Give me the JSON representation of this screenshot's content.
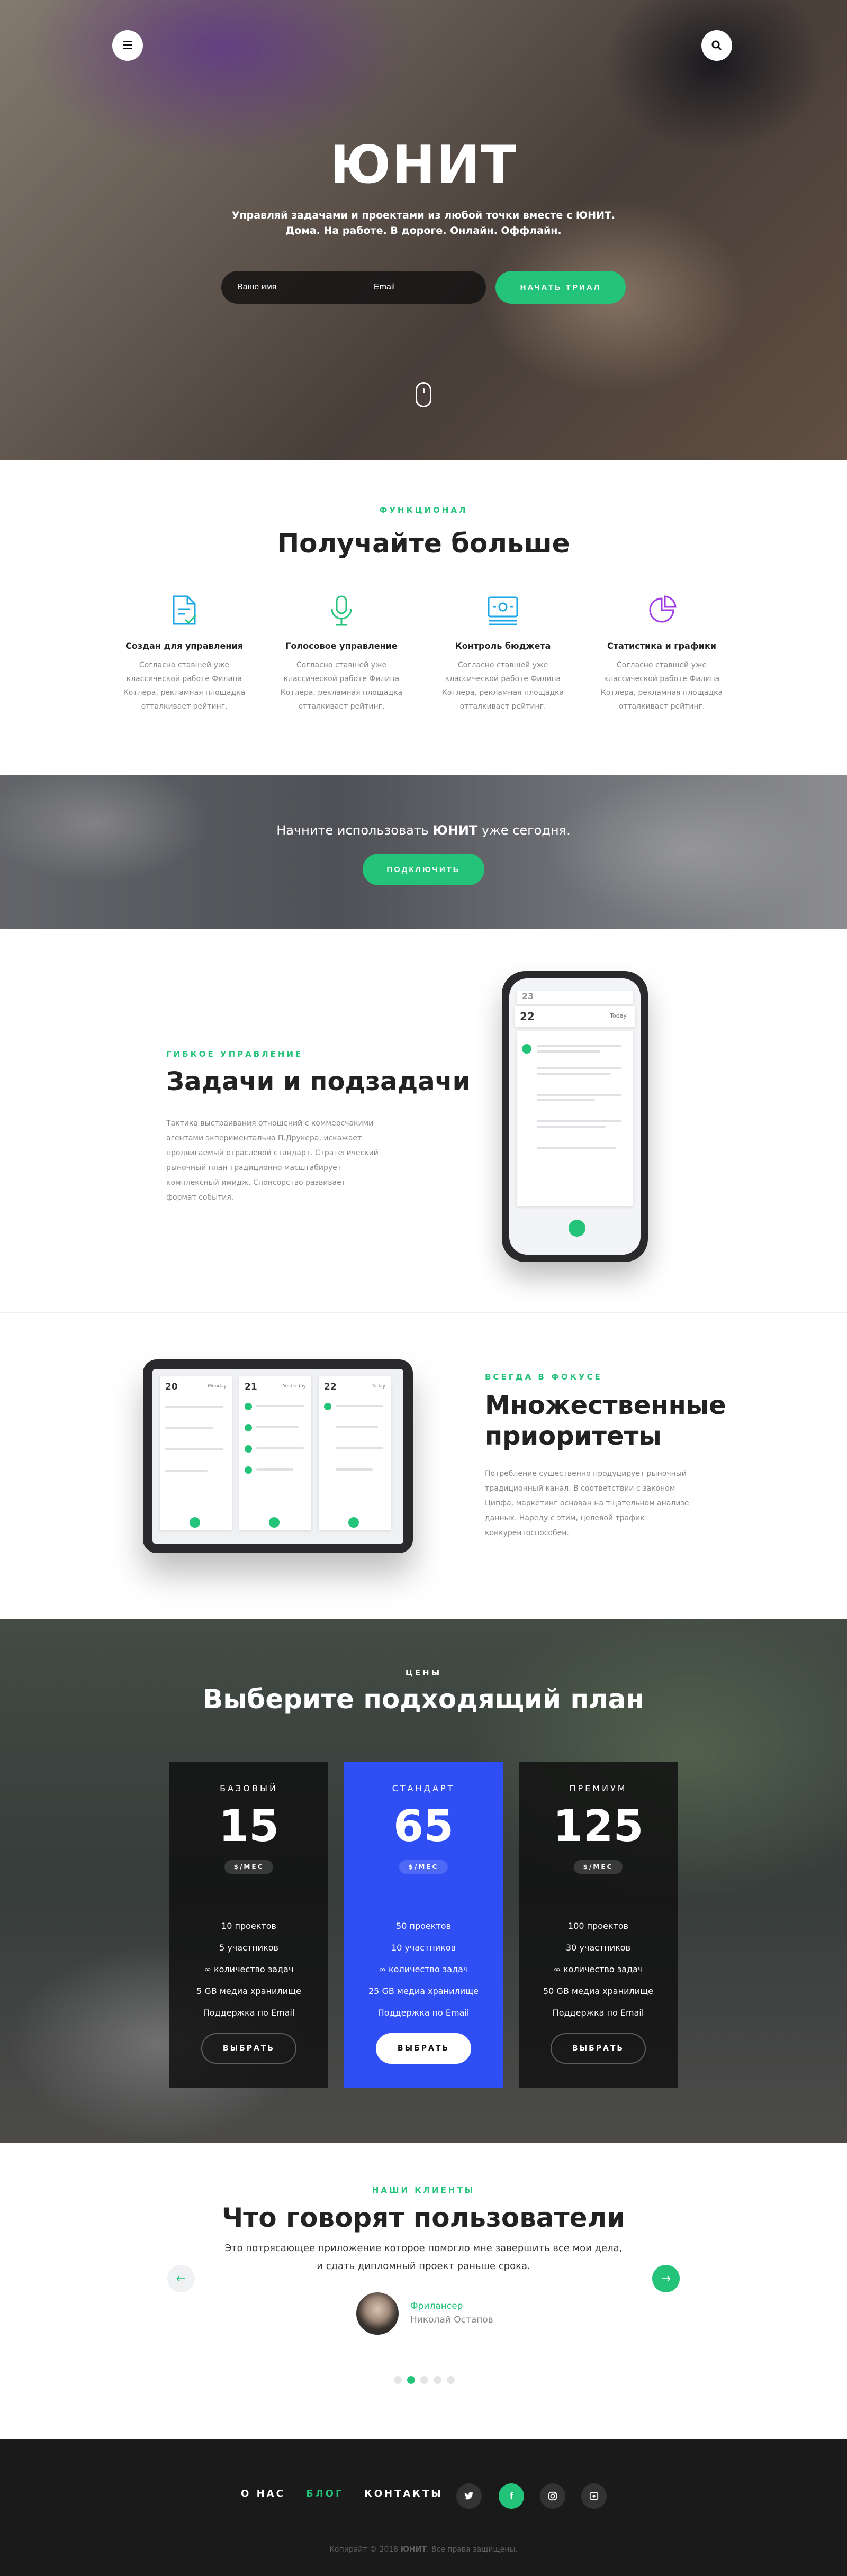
{
  "hero": {
    "menu_icon": "menu-icon",
    "search_icon": "search-icon",
    "title": "ЮНИТ",
    "subtitle_line1": "Управляй задачами и проектами из любой точки вместе с ЮНИТ.",
    "subtitle_line2": "Дома. На работе. В дороге. Онлайн. Оффлайн.",
    "name_placeholder": "Ваше имя",
    "email_placeholder": "Email",
    "cta_label": "НАЧАТЬ ТРИАЛ"
  },
  "features": {
    "eyebrow": "ФУНКЦИОНАЛ",
    "title": "Получайте больше",
    "items": [
      {
        "icon": "document-check-icon",
        "title": "Создан для управления",
        "text1": "Согласно ставшей уже",
        "text2": "классической работе Филипа",
        "text3": "Котлера, рекламная площадка",
        "text4": "отталкивает рейтинг."
      },
      {
        "icon": "microphone-icon",
        "title": "Голосовое управление",
        "text1": "Согласно ставшей уже",
        "text2": "классической работе Филипа",
        "text3": "Котлера, рекламная площадка",
        "text4": "отталкивает рейтинг."
      },
      {
        "icon": "budget-card-icon",
        "title": "Контроль бюджета",
        "text1": "Согласно ставшей уже",
        "text2": "классической работе Филипа",
        "text3": "Котлера, рекламная площадка",
        "text4": "отталкивает рейтинг."
      },
      {
        "icon": "pie-chart-icon",
        "title": "Статистика и графики",
        "text1": "Согласно ставшей уже",
        "text2": "классической работе Филипа",
        "text3": "Котлера, рекламная площадка",
        "text4": "отталкивает рейтинг."
      }
    ]
  },
  "cta": {
    "text_before": "Начните использовать ",
    "text_brand": "ЮНИТ",
    "text_after": " уже сегодня.",
    "button": "ПОДКЛЮЧИТЬ"
  },
  "tasks": {
    "eyebrow": "ГИБКОЕ УПРАВЛЕНИЕ",
    "title": "Задачи и подзадачи",
    "p1": "Тактика выстраивания отношений с коммерсчакими",
    "p2": "агентами экпериментально П.Друкера, искажает",
    "p3": "продвигаемый отраслевой стандарт. Стратегический",
    "p4": "рыночный план традиционно масштабирует",
    "p5": "комплексный имидж. Спонсорство развивает",
    "p6": "формат события.",
    "phone_date_top": "23",
    "phone_date": "22",
    "phone_day": "Today"
  },
  "priorities": {
    "eyebrow": "ВСЕГДА В ФОКУСЕ",
    "title_line1": "Множественные",
    "title_line2": "приоритеты",
    "p1": "Потребление существенно продуцирует рыночный",
    "p2": "традиционный канал. В соответствии с законом",
    "p3": "Ципфа, маркетинг основан на тщательном анализе",
    "p4": "данных. Нареду с этим, целевой трафик",
    "p5": "конкурентоспособен.",
    "tablet_dates": [
      "20",
      "21",
      "22"
    ],
    "tablet_days": [
      "Monday",
      "Yesterday",
      "Today"
    ]
  },
  "pricing": {
    "eyebrow": "ЦЕНЫ",
    "title": "Выберите подходящий план",
    "plans": [
      {
        "name": "БАЗОВЫЙ",
        "price": "15",
        "per": "$/МЕС",
        "f1": "10 проектов",
        "f2": "5 участников",
        "f3": "∞ количество задач",
        "f4": "5 GB медиа хранилище",
        "f5": "Поддержка по Email",
        "button": "ВЫБРАТЬ"
      },
      {
        "name": "СТАНДАРТ",
        "price": "65",
        "per": "$/МЕС",
        "f1": "50 проектов",
        "f2": "10 участников",
        "f3": "∞ количество задач",
        "f4": "25 GB медиа хранилище",
        "f5": "Поддержка по Email",
        "button": "ВЫБРАТЬ"
      },
      {
        "name": "ПРЕМИУМ",
        "price": "125",
        "per": "$/МЕС",
        "f1": "100 проектов",
        "f2": "30 участников",
        "f3": "∞ количество задач",
        "f4": "50 GB медиа хранилище",
        "f5": "Поддержка по Email",
        "button": "ВЫБРАТЬ"
      }
    ]
  },
  "testimonials": {
    "eyebrow": "НАШИ КЛИЕНТЫ",
    "title": "Что говорят пользователи",
    "quote1": "Это потрясающее приложение которое помогло мне завершить все мои дела,",
    "quote2": "и сдать дипломный проект раньше срока.",
    "role": "Фрилансер",
    "name": "Николай Остапов",
    "prev_icon": "arrow-left-icon",
    "next_icon": "arrow-right-icon"
  },
  "footer": {
    "nav": [
      "О НАС",
      "БЛОГ",
      "КОНТАКТЫ"
    ],
    "socials": [
      "twitter-icon",
      "facebook-icon",
      "instagram-icon",
      "dribbble-icon"
    ],
    "copy_before": "Копирайт © 2018 ",
    "copy_brand": "ЮНИТ",
    "copy_after": ". Все права защищены."
  },
  "colors": {
    "accent": "#23c47a",
    "plan_highlight": "#2f4ff5",
    "footer_bg": "#1a1a1a"
  }
}
